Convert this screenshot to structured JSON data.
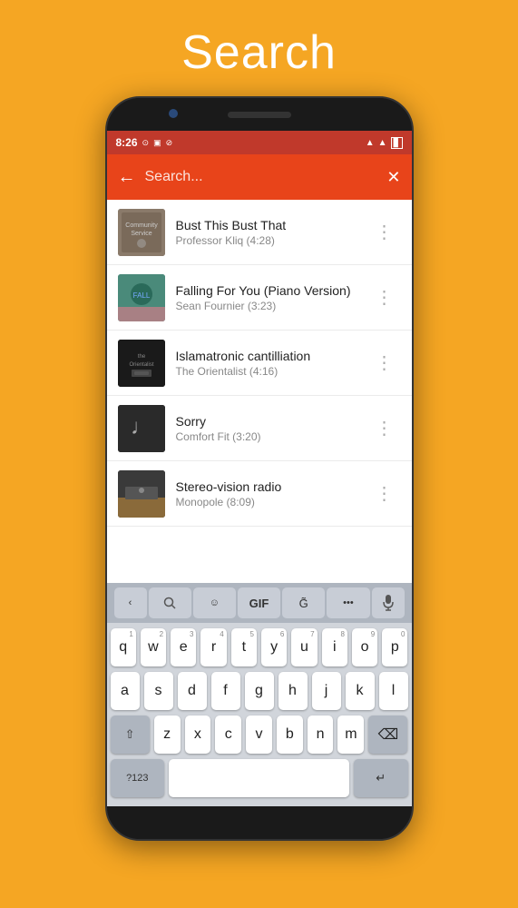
{
  "page": {
    "title": "Search",
    "bg_color": "#F5A623"
  },
  "status_bar": {
    "time": "8:26",
    "icons": [
      "●",
      "▲",
      "◀"
    ]
  },
  "search_bar": {
    "placeholder": "Search...",
    "back_label": "←",
    "close_label": "✕"
  },
  "songs": [
    {
      "id": 1,
      "title": "Bust This Bust That",
      "subtitle": "Professor Kliq (4:28)",
      "art_class": "art-community"
    },
    {
      "id": 2,
      "title": "Falling For You (Piano Version)",
      "subtitle": "Sean Fournier (3:23)",
      "art_class": "art-falling"
    },
    {
      "id": 3,
      "title": "Islamatronic cantilliation",
      "subtitle": "The Orientalist (4:16)",
      "art_class": "art-islam"
    },
    {
      "id": 4,
      "title": "Sorry",
      "subtitle": "Comfort Fit (3:20)",
      "art_class": "art-sorry"
    },
    {
      "id": 5,
      "title": "Stereo-vision radio",
      "subtitle": "Monopole (8:09)",
      "art_class": "art-stereo"
    }
  ],
  "keyboard": {
    "toolbar_items": [
      "‹",
      "🔍",
      "☺",
      "GIF",
      "G̃",
      "•••",
      "🎤"
    ],
    "row1": [
      {
        "key": "q",
        "num": "1"
      },
      {
        "key": "w",
        "num": "2"
      },
      {
        "key": "e",
        "num": "3"
      },
      {
        "key": "r",
        "num": "4"
      },
      {
        "key": "t",
        "num": "5"
      },
      {
        "key": "y",
        "num": "6"
      },
      {
        "key": "u",
        "num": "7"
      },
      {
        "key": "i",
        "num": "8"
      },
      {
        "key": "o",
        "num": "9"
      },
      {
        "key": "p",
        "num": "0"
      }
    ],
    "row2": [
      {
        "key": "a"
      },
      {
        "key": "s"
      },
      {
        "key": "d"
      },
      {
        "key": "f"
      },
      {
        "key": "g"
      },
      {
        "key": "h"
      },
      {
        "key": "j"
      },
      {
        "key": "k"
      },
      {
        "key": "l"
      }
    ],
    "row3_shift": "⇧",
    "row3": [
      {
        "key": "z"
      },
      {
        "key": "x"
      },
      {
        "key": "c"
      },
      {
        "key": "v"
      },
      {
        "key": "b"
      },
      {
        "key": "n"
      },
      {
        "key": "m"
      }
    ],
    "row3_delete": "⌫",
    "row4_special": "?123",
    "row4_space": "",
    "row4_enter": "↵"
  }
}
